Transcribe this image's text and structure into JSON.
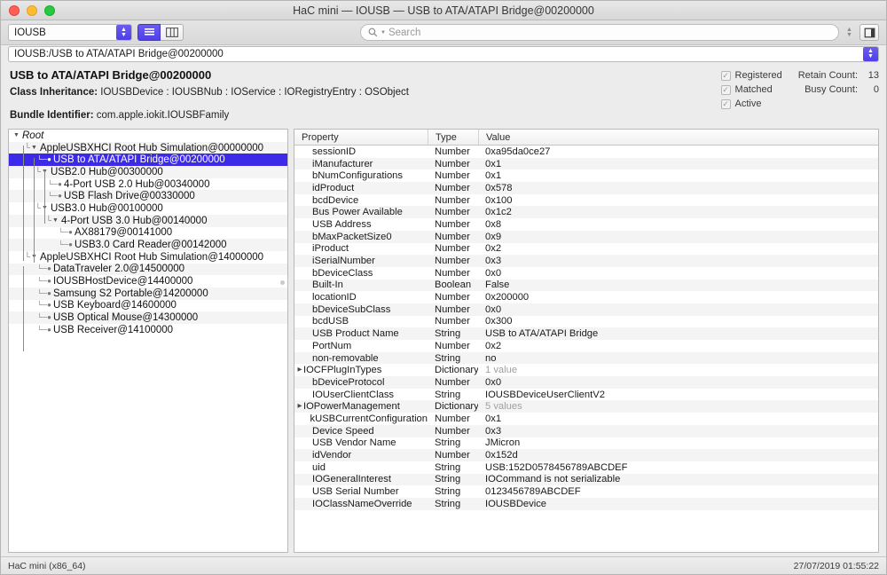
{
  "window": {
    "title": "HaC mini — IOUSB — USB to ATA/ATAPI Bridge@00200000",
    "accent_blue": "#4f3fe8",
    "selection_blue": "#3c2ae8"
  },
  "toolbar": {
    "plane_value": "IOUSB",
    "search_placeholder": "Search",
    "search_value": "",
    "view_list_icon": "list-view-icon",
    "view_column_icon": "column-view-icon",
    "inspector_icon": "inspector-toggle-icon",
    "search_icon": "search-icon",
    "stepper_up": "▲",
    "stepper_down": "▼"
  },
  "pathbar": {
    "value": "IOUSB:/USB to ATA/ATAPI Bridge@00200000"
  },
  "info": {
    "node_title": "USB to ATA/ATAPI Bridge@00200000",
    "class_inheritance_label": "Class Inheritance:",
    "class_inheritance_value": "IOUSBDevice : IOUSBNub : IOService : IORegistryEntry : OSObject",
    "bundle_label": "Bundle Identifier:",
    "bundle_value": "com.apple.iokit.IOUSBFamily",
    "flags": [
      {
        "label": "Registered",
        "checked": true
      },
      {
        "label": "Matched",
        "checked": true
      },
      {
        "label": "Active",
        "checked": true
      }
    ],
    "counts": [
      {
        "label": "Retain Count:",
        "value": "13"
      },
      {
        "label": "Busy Count:",
        "value": "0"
      }
    ]
  },
  "tree": {
    "rows": [
      {
        "label": "Root",
        "depth": 0,
        "disclosure": "open",
        "leaf": false,
        "italic": true,
        "selected": false
      },
      {
        "label": "AppleUSBXHCI Root Hub Simulation@00000000",
        "depth": 1,
        "disclosure": "open",
        "leaf": false,
        "italic": false,
        "selected": false
      },
      {
        "label": "USB to ATA/ATAPI Bridge@00200000",
        "depth": 2,
        "disclosure": "none",
        "leaf": true,
        "italic": false,
        "selected": true
      },
      {
        "label": "USB2.0 Hub@00300000",
        "depth": 2,
        "disclosure": "open",
        "leaf": false,
        "italic": false,
        "selected": false
      },
      {
        "label": "4-Port USB 2.0 Hub@00340000",
        "depth": 3,
        "disclosure": "none",
        "leaf": true,
        "italic": false,
        "selected": false
      },
      {
        "label": "USB Flash Drive@00330000",
        "depth": 3,
        "disclosure": "none",
        "leaf": true,
        "italic": false,
        "selected": false
      },
      {
        "label": "USB3.0 Hub@00100000",
        "depth": 2,
        "disclosure": "open",
        "leaf": false,
        "italic": false,
        "selected": false
      },
      {
        "label": "4-Port USB 3.0 Hub@00140000",
        "depth": 3,
        "disclosure": "open",
        "leaf": false,
        "italic": false,
        "selected": false
      },
      {
        "label": "AX88179@00141000",
        "depth": 4,
        "disclosure": "none",
        "leaf": true,
        "italic": false,
        "selected": false
      },
      {
        "label": "USB3.0 Card Reader@00142000",
        "depth": 4,
        "disclosure": "none",
        "leaf": true,
        "italic": false,
        "selected": false
      },
      {
        "label": "AppleUSBXHCI Root Hub Simulation@14000000",
        "depth": 1,
        "disclosure": "open",
        "leaf": false,
        "italic": false,
        "selected": false
      },
      {
        "label": "DataTraveler 2.0@14500000",
        "depth": 2,
        "disclosure": "none",
        "leaf": true,
        "italic": false,
        "selected": false
      },
      {
        "label": "IOUSBHostDevice@14400000",
        "depth": 2,
        "disclosure": "none",
        "leaf": true,
        "italic": false,
        "selected": false
      },
      {
        "label": "Samsung S2 Portable@14200000",
        "depth": 2,
        "disclosure": "none",
        "leaf": true,
        "italic": false,
        "selected": false
      },
      {
        "label": "USB Keyboard@14600000",
        "depth": 2,
        "disclosure": "none",
        "leaf": true,
        "italic": false,
        "selected": false
      },
      {
        "label": "USB Optical Mouse@14300000",
        "depth": 2,
        "disclosure": "none",
        "leaf": true,
        "italic": false,
        "selected": false
      },
      {
        "label": "USB Receiver@14100000",
        "depth": 2,
        "disclosure": "none",
        "leaf": true,
        "italic": false,
        "selected": false
      }
    ]
  },
  "properties": {
    "columns": [
      "Property",
      "Type",
      "Value"
    ],
    "rows": [
      {
        "property": "sessionID",
        "type": "Number",
        "value": "0xa95da0ce27",
        "expandable": false,
        "dim": false
      },
      {
        "property": "iManufacturer",
        "type": "Number",
        "value": "0x1",
        "expandable": false,
        "dim": false
      },
      {
        "property": "bNumConfigurations",
        "type": "Number",
        "value": "0x1",
        "expandable": false,
        "dim": false
      },
      {
        "property": "idProduct",
        "type": "Number",
        "value": "0x578",
        "expandable": false,
        "dim": false
      },
      {
        "property": "bcdDevice",
        "type": "Number",
        "value": "0x100",
        "expandable": false,
        "dim": false
      },
      {
        "property": "Bus Power Available",
        "type": "Number",
        "value": "0x1c2",
        "expandable": false,
        "dim": false
      },
      {
        "property": "USB Address",
        "type": "Number",
        "value": "0x8",
        "expandable": false,
        "dim": false
      },
      {
        "property": "bMaxPacketSize0",
        "type": "Number",
        "value": "0x9",
        "expandable": false,
        "dim": false
      },
      {
        "property": "iProduct",
        "type": "Number",
        "value": "0x2",
        "expandable": false,
        "dim": false
      },
      {
        "property": "iSerialNumber",
        "type": "Number",
        "value": "0x3",
        "expandable": false,
        "dim": false
      },
      {
        "property": "bDeviceClass",
        "type": "Number",
        "value": "0x0",
        "expandable": false,
        "dim": false
      },
      {
        "property": "Built-In",
        "type": "Boolean",
        "value": "False",
        "expandable": false,
        "dim": false
      },
      {
        "property": "locationID",
        "type": "Number",
        "value": "0x200000",
        "expandable": false,
        "dim": false
      },
      {
        "property": "bDeviceSubClass",
        "type": "Number",
        "value": "0x0",
        "expandable": false,
        "dim": false
      },
      {
        "property": "bcdUSB",
        "type": "Number",
        "value": "0x300",
        "expandable": false,
        "dim": false
      },
      {
        "property": "USB Product Name",
        "type": "String",
        "value": "USB to ATA/ATAPI Bridge",
        "expandable": false,
        "dim": false
      },
      {
        "property": "PortNum",
        "type": "Number",
        "value": "0x2",
        "expandable": false,
        "dim": false
      },
      {
        "property": "non-removable",
        "type": "String",
        "value": "no",
        "expandable": false,
        "dim": false
      },
      {
        "property": "IOCFPlugInTypes",
        "type": "Dictionary",
        "value": "1 value",
        "expandable": true,
        "dim": true
      },
      {
        "property": "bDeviceProtocol",
        "type": "Number",
        "value": "0x0",
        "expandable": false,
        "dim": false
      },
      {
        "property": "IOUserClientClass",
        "type": "String",
        "value": "IOUSBDeviceUserClientV2",
        "expandable": false,
        "dim": false
      },
      {
        "property": "IOPowerManagement",
        "type": "Dictionary",
        "value": "5 values",
        "expandable": true,
        "dim": true
      },
      {
        "property": "kUSBCurrentConfiguration",
        "type": "Number",
        "value": "0x1",
        "expandable": false,
        "dim": false
      },
      {
        "property": "Device Speed",
        "type": "Number",
        "value": "0x3",
        "expandable": false,
        "dim": false
      },
      {
        "property": "USB Vendor Name",
        "type": "String",
        "value": "JMicron",
        "expandable": false,
        "dim": false
      },
      {
        "property": "idVendor",
        "type": "Number",
        "value": "0x152d",
        "expandable": false,
        "dim": false
      },
      {
        "property": "uid",
        "type": "String",
        "value": "USB:152D0578456789ABCDEF",
        "expandable": false,
        "dim": false
      },
      {
        "property": "IOGeneralInterest",
        "type": "String",
        "value": "IOCommand is not serializable",
        "expandable": false,
        "dim": false
      },
      {
        "property": "USB Serial Number",
        "type": "String",
        "value": "0123456789ABCDEF",
        "expandable": false,
        "dim": false
      },
      {
        "property": "IOClassNameOverride",
        "type": "String",
        "value": "IOUSBDevice",
        "expandable": false,
        "dim": false
      }
    ]
  },
  "statusbar": {
    "host": "HaC mini (x86_64)",
    "timestamp": "27/07/2019 01:55:22"
  }
}
